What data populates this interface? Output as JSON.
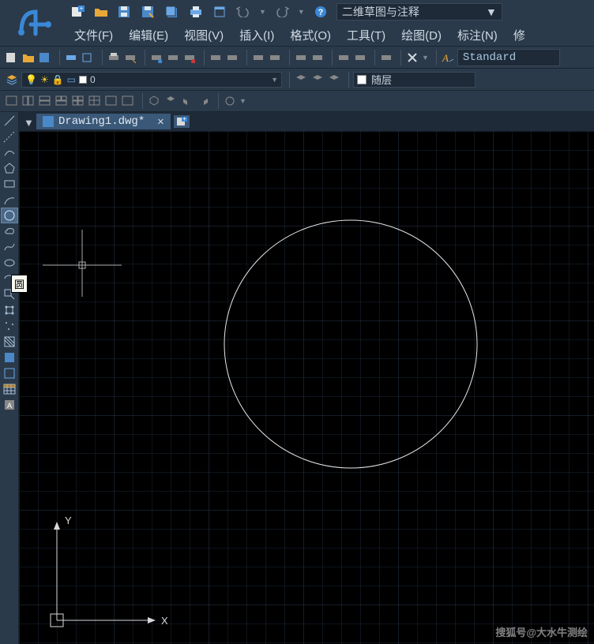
{
  "workspace_selector": "二维草图与注释",
  "menu": {
    "file": "文件(F)",
    "edit": "编辑(E)",
    "view": "视图(V)",
    "insert": "插入(I)",
    "format": "格式(O)",
    "tools": "工具(T)",
    "draw": "绘图(D)",
    "annotate": "标注(N)",
    "more": "修"
  },
  "text_style": "Standard",
  "layer": {
    "current": "0"
  },
  "layer_prop": "随层",
  "tab": {
    "title": "Drawing1.dwg*"
  },
  "tooltip": "圆",
  "ucs": {
    "x_label": "X",
    "y_label": "Y"
  },
  "watermark": "搜狐号@大水牛测绘"
}
